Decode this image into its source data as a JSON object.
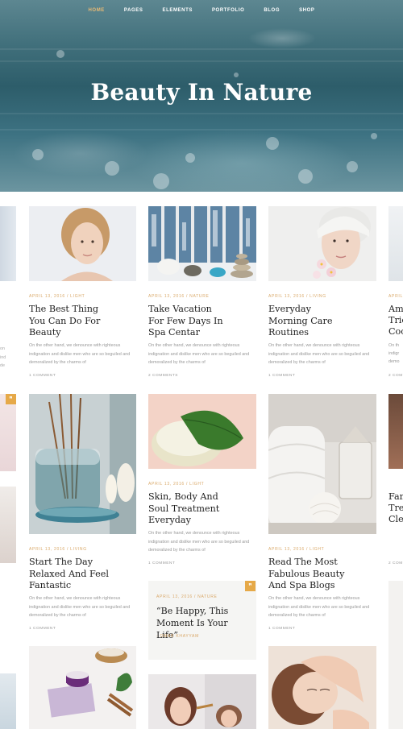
{
  "nav": {
    "items": [
      "HOME",
      "PAGES",
      "ELEMENTS",
      "PORTFOLIO",
      "BLOG",
      "SHOP"
    ]
  },
  "hero": {
    "title": "Beauty In Nature"
  },
  "posts": [
    {
      "meta": "APRIL 13, 2016 / LIGHT",
      "title": "The Best Thing You Can Do For Beauty",
      "excerpt": "On the other hand, we denounce with righteous indignation and dislike men who are so beguiled and demoralized by the charms of",
      "comments": "1 COMMENT"
    },
    {
      "meta": "APRIL 13, 2016 / NATURE",
      "title": "Take Vacation For Few Days In Spa Centar",
      "excerpt": "On the other hand, we denounce with righteous indignation and dislike men who are so beguiled and demoralized by the charms of",
      "comments": "2 COMMENTS"
    },
    {
      "meta": "APRIL 13, 2016 / LIVING",
      "title": "Everyday Morning Care Routines",
      "excerpt": "On the other hand, we denounce with righteous indignation and dislike men who are so beguiled and demoralized by the charms of",
      "comments": "1 COMMENT"
    },
    {
      "meta": "APRIL 13, 2016 / LIVING",
      "title": "Start The Day Relaxed And Feel Fantastic",
      "excerpt": "On the other hand, we denounce with righteous indignation and dislike men who are so beguiled and demoralized by the charms of",
      "comments": "1 COMMENT"
    },
    {
      "meta": "APRIL 13, 2016 / LIGHT",
      "title": "Skin, Body And Soul Treatment Everyday",
      "excerpt": "On the other hand, we denounce with righteous indignation and dislike men who are so beguiled and demoralized by the charms of",
      "comments": "1 COMMENT"
    },
    {
      "meta": "APRIL 13, 2016 / LIGHT",
      "title": "Read The Most Fabulous Beauty And Spa Blogs",
      "excerpt": "On the other hand, we denounce with righteous indignation and dislike men who are so beguiled and demoralized by the charms of",
      "comments": "1 COMMENT"
    }
  ],
  "quote": {
    "meta": "APRIL 13, 2016 / NATURE",
    "text": "“Be Happy, This Moment Is Your Life”",
    "author": "- OMAR KHAYYAM",
    "badge": "❞"
  },
  "partial": {
    "right_titles": [
      "Am",
      "Tric",
      "Coo"
    ],
    "right_titles_2": [
      "Fam",
      "Tre",
      "Clea"
    ],
    "right_comments": "2 COM",
    "right_meta": "APRIL",
    "right_excerpt": [
      "On th",
      "indigr",
      "demo"
    ]
  },
  "colors": {
    "accent": "#e6a948",
    "meta": "#d9a868",
    "nav_active": "#e8b974"
  }
}
